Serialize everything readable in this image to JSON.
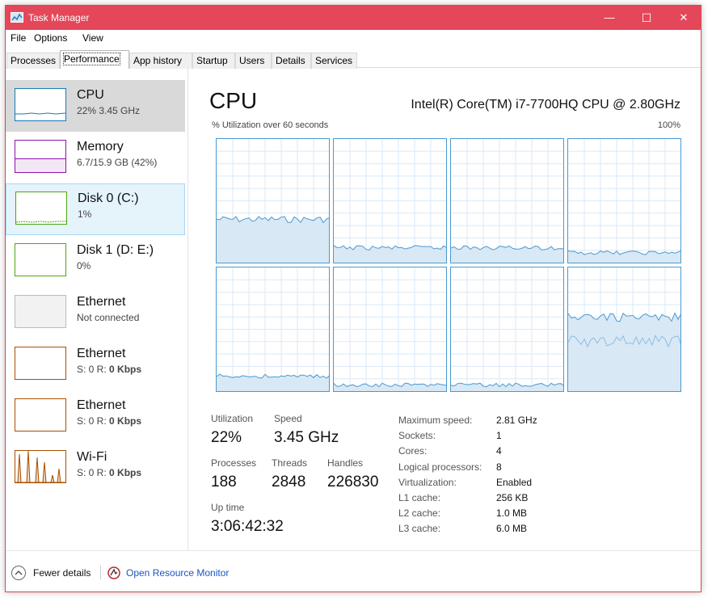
{
  "window": {
    "title": "Task Manager",
    "minimize": "—",
    "maximize": "☐",
    "close": "✕"
  },
  "menu": {
    "file": "File",
    "options": "Options",
    "view": "View"
  },
  "tabs": [
    "Processes",
    "Performance",
    "App history",
    "Startup",
    "Users",
    "Details",
    "Services"
  ],
  "sidebar": [
    {
      "name": "CPU",
      "sub": "22% 3.45 GHz",
      "color": "#117dbb"
    },
    {
      "name": "Memory",
      "sub": "6.7/15.9 GB (42%)",
      "color": "#8b12ae"
    },
    {
      "name": "Disk 0 (C:)",
      "sub": "1%",
      "color": "#4da60c"
    },
    {
      "name": "Disk 1 (D: E:)",
      "sub": "0%",
      "color": "#4da60c"
    },
    {
      "name": "Ethernet",
      "sub": "Not connected",
      "color": "#999999"
    },
    {
      "name": "Ethernet",
      "sub_prefix": "S: 0 R: ",
      "sub_bold": "0 Kbps",
      "color": "#a74f01"
    },
    {
      "name": "Ethernet",
      "sub_prefix": "S: 0 R: ",
      "sub_bold": "0 Kbps",
      "color": "#a74f01"
    },
    {
      "name": "Wi-Fi",
      "sub_prefix": "S: 0 R: ",
      "sub_bold": "0 Kbps",
      "color": "#a74f01"
    }
  ],
  "cpu": {
    "title": "CPU",
    "model": "Intel(R) Core(TM) i7-7700HQ CPU @ 2.80GHz",
    "graph_label": "% Utilization over 60 seconds",
    "graph_max": "100%",
    "core_levels": [
      0.35,
      0.12,
      0.12,
      0.08,
      0.12,
      0.05,
      0.05,
      0.6
    ]
  },
  "stats": {
    "utilization_label": "Utilization",
    "utilization": "22%",
    "speed_label": "Speed",
    "speed": "3.45 GHz",
    "processes_label": "Processes",
    "processes": "188",
    "threads_label": "Threads",
    "threads": "2848",
    "handles_label": "Handles",
    "handles": "226830",
    "uptime_label": "Up time",
    "uptime": "3:06:42:32"
  },
  "specs": [
    {
      "k": "Maximum speed:",
      "v": "2.81 GHz"
    },
    {
      "k": "Sockets:",
      "v": "1"
    },
    {
      "k": "Cores:",
      "v": "4"
    },
    {
      "k": "Logical processors:",
      "v": "8"
    },
    {
      "k": "Virtualization:",
      "v": "Enabled"
    },
    {
      "k": "L1 cache:",
      "v": "256 KB"
    },
    {
      "k": "L2 cache:",
      "v": "1.0 MB"
    },
    {
      "k": "L3 cache:",
      "v": "6.0 MB"
    }
  ],
  "footer": {
    "fewer": "Fewer details",
    "monitor": "Open Resource Monitor"
  },
  "colors": {
    "title_bar": "#e5475a",
    "graph_line": "#117dbb",
    "graph_fill": "#d9e8f5",
    "link": "#1a56c2"
  }
}
